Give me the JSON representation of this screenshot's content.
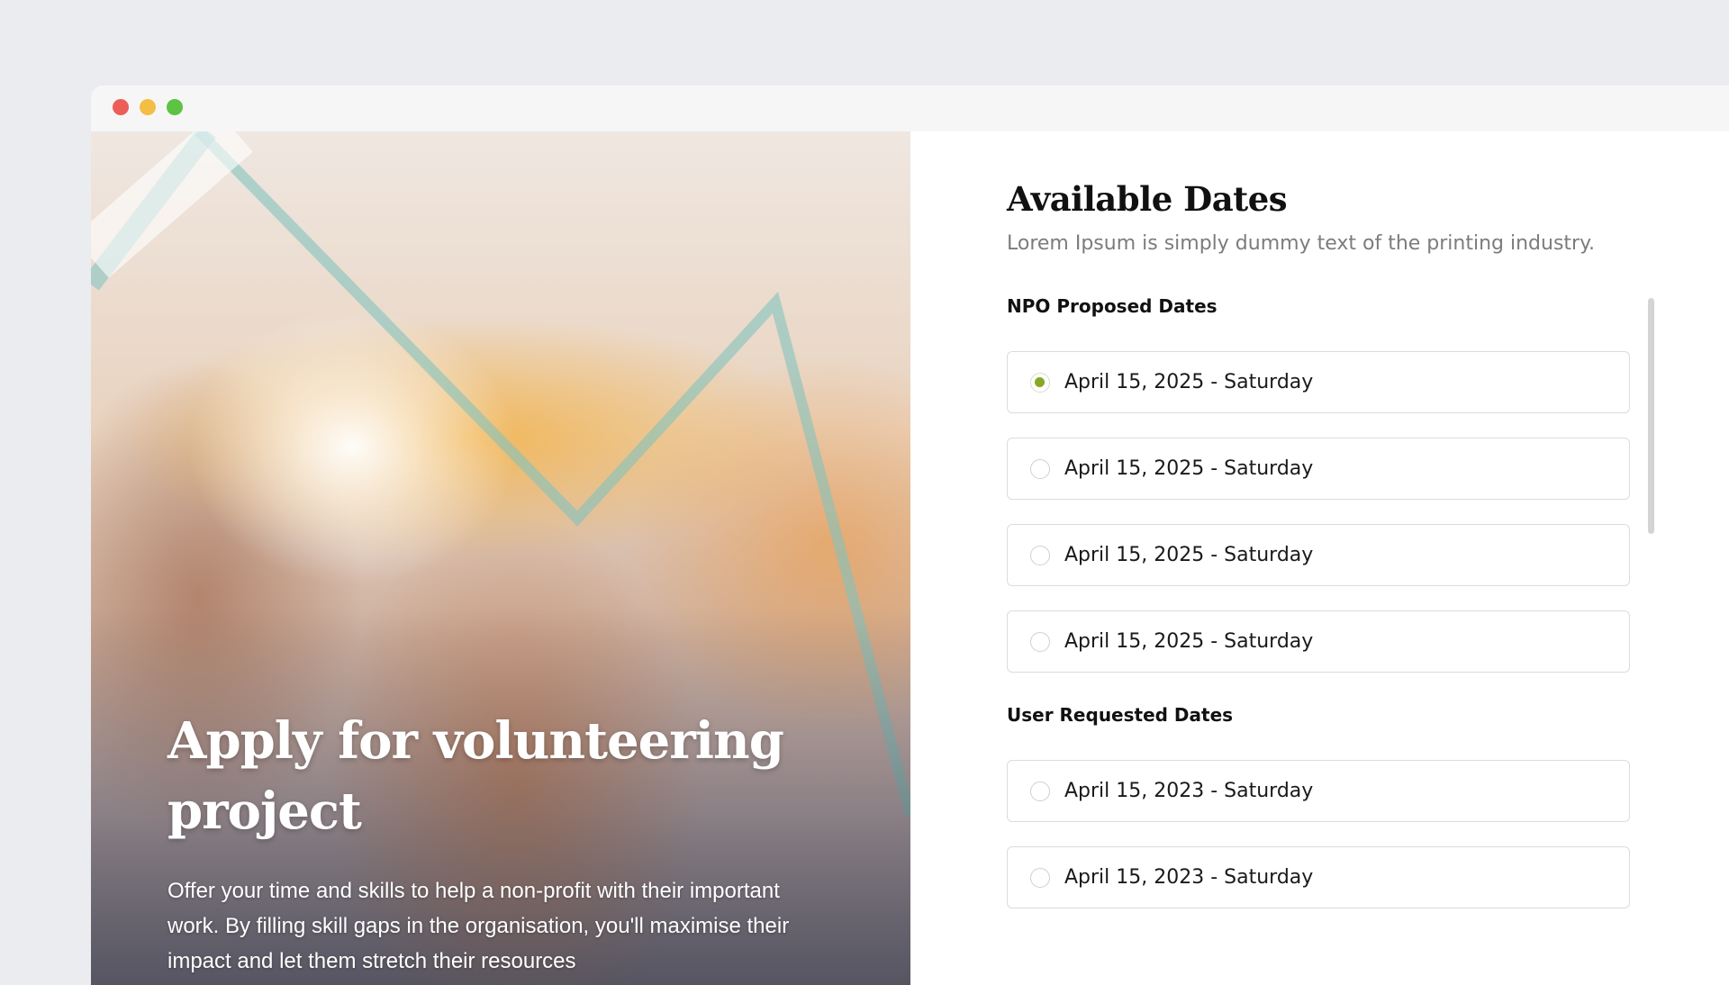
{
  "hero": {
    "title": "Apply for volunteering project",
    "description": "Offer your time and skills to help a non-profit with their important work. By filling skill gaps in the organisation, you'll maximise their impact and let them stretch their resources"
  },
  "panel": {
    "title": "Available Dates",
    "subtitle": "Lorem Ipsum is simply dummy text of the printing industry."
  },
  "npo_section": {
    "label": "NPO Proposed Dates",
    "options": [
      {
        "label": "April 15, 2025 - Saturday",
        "selected": true
      },
      {
        "label": "April 15, 2025 - Saturday",
        "selected": false
      },
      {
        "label": "April 15, 2025 - Saturday",
        "selected": false
      },
      {
        "label": "April 15, 2025 - Saturday",
        "selected": false
      }
    ]
  },
  "user_section": {
    "label": "User Requested Dates",
    "options": [
      {
        "label": "April 15, 2023 - Saturday",
        "selected": false
      },
      {
        "label": "April 15, 2023 - Saturday",
        "selected": false
      }
    ]
  },
  "colors": {
    "accent": "#86a829",
    "border": "#dcdcdc",
    "page_background": "#ebecef"
  }
}
